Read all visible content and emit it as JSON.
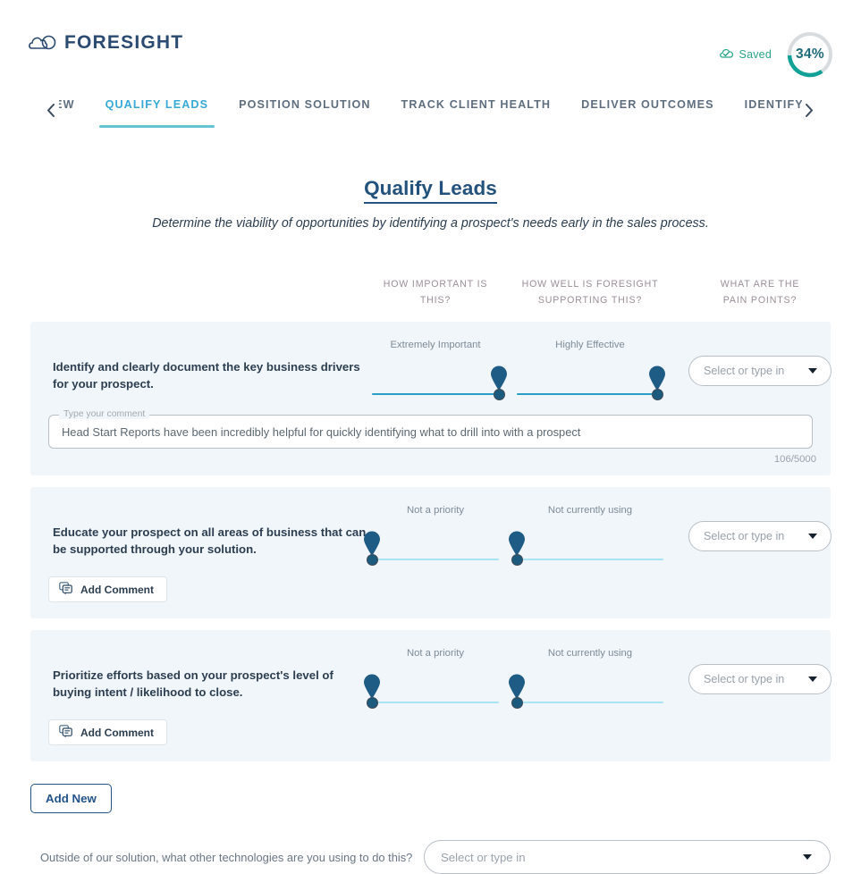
{
  "brand": {
    "name": "FORESIGHT",
    "logo_icon": "cloud-logo-icon"
  },
  "header": {
    "saved_label": "Saved",
    "saved_icon": "cloud-check-icon",
    "progress_percent": "34%",
    "progress_value": 34,
    "progress_color": "#12a196",
    "progress_track_color": "#d8dcdf"
  },
  "tabs": {
    "prev_icon": "chevron-left-icon",
    "next_icon": "chevron-right-icon",
    "items": [
      {
        "label": "RVIEW",
        "active": false
      },
      {
        "label": "QUALIFY LEADS",
        "active": true
      },
      {
        "label": "POSITION SOLUTION",
        "active": false
      },
      {
        "label": "TRACK CLIENT HEALTH",
        "active": false
      },
      {
        "label": "DELIVER OUTCOMES",
        "active": false
      },
      {
        "label": "IDENTIFY MARK",
        "active": false
      }
    ]
  },
  "page": {
    "title": "Qualify Leads",
    "subtitle": "Determine the viability of opportunities by identifying a prospect's needs early in the sales process."
  },
  "columns": {
    "importance": "HOW IMPORTANT IS THIS?",
    "support_line1": "HOW WELL IS FORESIGHT",
    "support_line2": "SUPPORTING THIS?",
    "pain_line1": "WHAT ARE THE",
    "pain_line2": "PAIN POINTS?"
  },
  "select_placeholder": "Select or type in",
  "rows": [
    {
      "text": "Identify and clearly document the key business drivers for your prospect.",
      "importance_caption": "Extremely Important",
      "importance_value": 100,
      "support_caption": "Highly Effective",
      "support_value": 96,
      "pain_placeholder": "Select or type in",
      "comment": {
        "legend": "Type your comment",
        "value": "Head Start Reports have been incredibly helpful for quickly identifying what to drill into with a prospect",
        "counter": "106/5000"
      },
      "add_comment_label": null
    },
    {
      "text": "Educate your prospect on all areas of business that can be supported through your solution.",
      "importance_caption": "Not a priority",
      "importance_value": 0,
      "support_caption": "Not currently using",
      "support_value": 0,
      "pain_placeholder": "Select or type in",
      "comment": null,
      "add_comment_label": "Add Comment"
    },
    {
      "text": "Prioritize efforts based on your prospect's level of buying intent / likelihood to close.",
      "importance_caption": "Not a priority",
      "importance_value": 0,
      "support_caption": "Not currently using",
      "support_value": 0,
      "pain_placeholder": "Select or type in",
      "comment": null,
      "add_comment_label": "Add Comment"
    }
  ],
  "add_new_label": "Add New",
  "footer": {
    "question": "Outside of our solution, what other technologies are you using to do this?",
    "select_placeholder": "Select or type in"
  },
  "icons": {
    "add_comment": "comment-bubbles-icon",
    "dropdown": "caret-down-icon"
  }
}
